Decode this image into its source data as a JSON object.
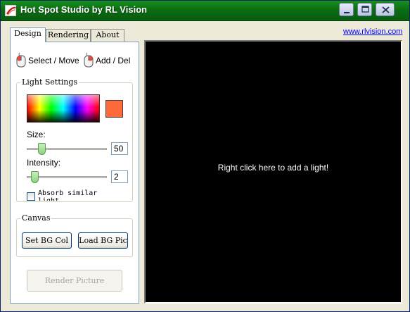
{
  "window": {
    "title": "Hot Spot Studio by RL Vision",
    "controls": [
      "minimize-icon",
      "maximize-icon",
      "close-icon"
    ]
  },
  "tabs": [
    {
      "label": "Design",
      "active": true
    },
    {
      "label": "Rendering",
      "active": false
    },
    {
      "label": "About",
      "active": false
    }
  ],
  "tools": {
    "select_move": {
      "label": "Select / Move",
      "icon": "mouse-icon"
    },
    "add_del": {
      "label": "Add / Del",
      "icon": "mouse-icon"
    }
  },
  "light_settings": {
    "caption": "Light Settings",
    "color_picker_icon": "color-spectrum",
    "selected_color": "#ff6a3d",
    "size_label": "Size:",
    "size_value": "50",
    "size_level": 0.16,
    "intensity_label": "Intensity:",
    "intensity_value": "2",
    "intensity_level": 0.06,
    "absorb_label": "Absorb similar light",
    "absorb_checked": false
  },
  "canvas_group": {
    "caption": "Canvas",
    "set_bg_col": "Set BG Col",
    "load_bg_pic": "Load BG Pic"
  },
  "render_button": {
    "label": "Render Picture",
    "enabled": false
  },
  "website_link": "www.rlvision.com",
  "canvas": {
    "hint": "Right click here to add a light!",
    "background": "#000000"
  },
  "colors": {
    "titlebar": "#0b6d13",
    "slider_thumb": "#8fd07f",
    "link": "#0000ff"
  }
}
